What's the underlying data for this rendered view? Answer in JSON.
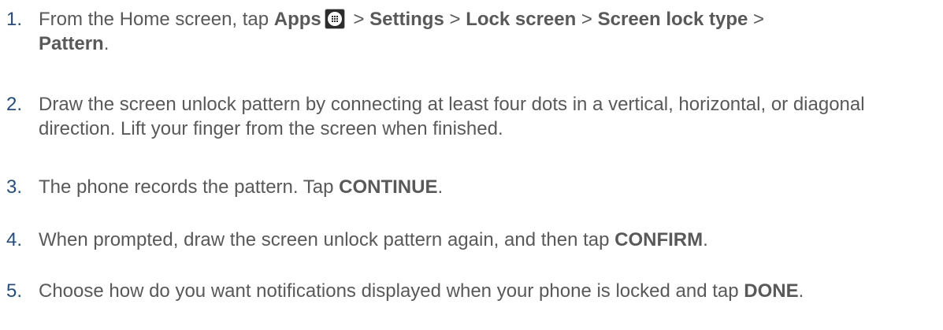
{
  "steps": [
    {
      "number": "1.",
      "t1": "From the Home screen, tap ",
      "b1": "Apps",
      "icon": "apps-grid-icon",
      "t2": " > ",
      "b2": "Settings",
      "t3": " > ",
      "b3": "Lock screen",
      "t4": " > ",
      "b4": "Screen lock type",
      "t5": " > ",
      "b5": "Pattern",
      "t6": "."
    },
    {
      "number": "2.",
      "t1": "Draw the screen unlock pattern by connecting at least four dots in a vertical, horizontal, or diagonal direction. Lift your finger from the screen when finished."
    },
    {
      "number": "3.",
      "t1": "The phone records the pattern. Tap ",
      "b1": "CONTINUE",
      "t2": "."
    },
    {
      "number": "4.",
      "t1": "When prompted, draw the screen unlock pattern again, and then tap ",
      "b1": "CONFIRM",
      "t2": "."
    },
    {
      "number": "5.",
      "t1": "Choose how do you want notifications displayed when your phone is locked and tap ",
      "b1": "DONE",
      "t2": "."
    }
  ]
}
